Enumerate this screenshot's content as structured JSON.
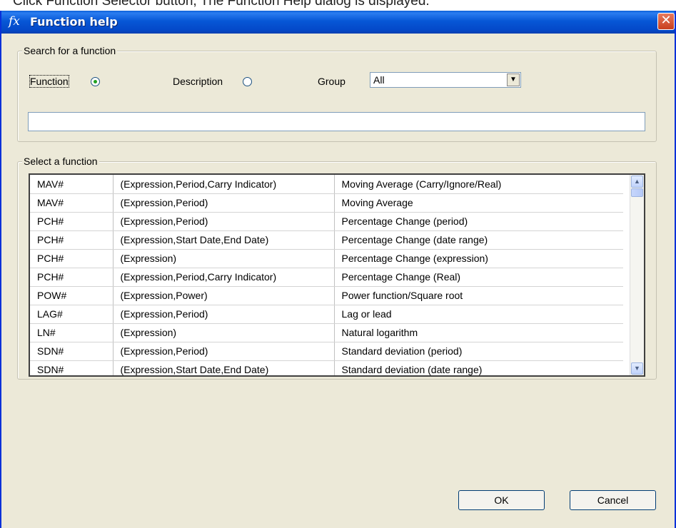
{
  "caption": {
    "prefix": "Click Function Selector",
    "underlined": "     ",
    "suffix": "button, The Function Help dialog is displayed."
  },
  "window": {
    "title": "Function help",
    "icon_glyph": "fx",
    "close_glyph": "✕"
  },
  "search": {
    "legend": "Search for a function",
    "function_label": "Function",
    "description_label": "Description",
    "group_label": "Group",
    "group_value": "All",
    "function_checked": true,
    "search_value": ""
  },
  "select": {
    "legend": "Select a function",
    "rows": [
      [
        "MAV#",
        "(Expression,Period,Carry Indicator)",
        "Moving Average (Carry/Ignore/Real)"
      ],
      [
        "MAV#",
        "(Expression,Period)",
        "Moving Average"
      ],
      [
        "PCH#",
        "(Expression,Period)",
        "Percentage Change (period)"
      ],
      [
        "PCH#",
        "(Expression,Start Date,End Date)",
        "Percentage Change (date range)"
      ],
      [
        "PCH#",
        "(Expression)",
        "Percentage Change (expression)"
      ],
      [
        "PCH#",
        "(Expression,Period,Carry Indicator)",
        "Percentage Change (Real)"
      ],
      [
        "POW#",
        "(Expression,Power)",
        "Power function/Square root"
      ],
      [
        "LAG#",
        "(Expression,Period)",
        "Lag or lead"
      ],
      [
        "LN#",
        "(Expression)",
        "Natural logarithm"
      ],
      [
        "SDN#",
        "(Expression,Period)",
        "Standard deviation (period)"
      ],
      [
        "SDN#",
        "(Expression,Start Date,End Date)",
        "Standard deviation (date range)"
      ]
    ]
  },
  "buttons": {
    "ok": "OK",
    "cancel": "Cancel"
  }
}
